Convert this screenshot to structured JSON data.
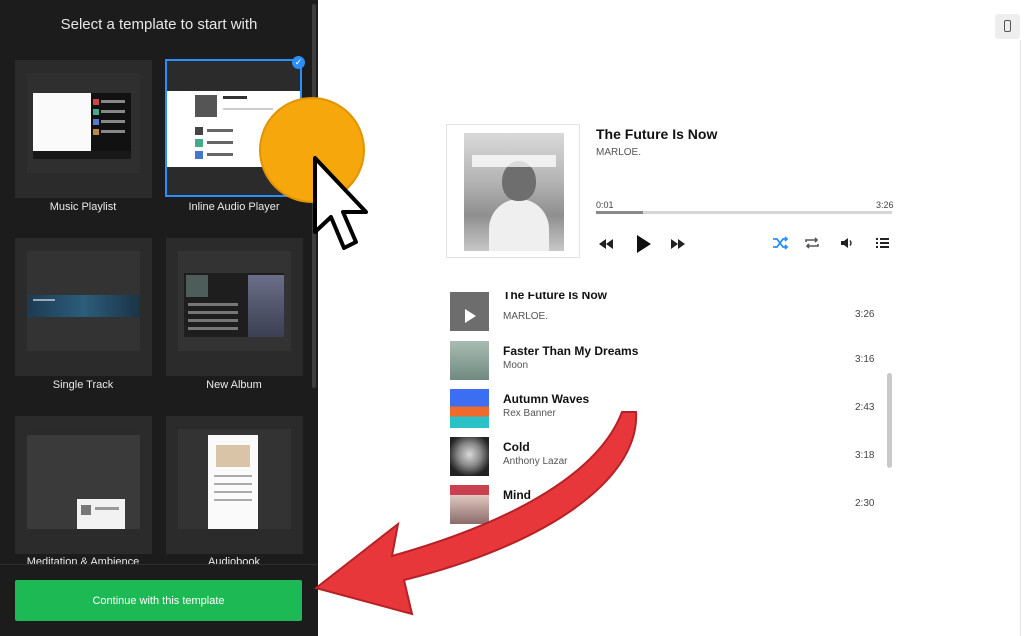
{
  "left_panel": {
    "title": "Select a template to start with",
    "templates": [
      {
        "label": "Music Playlist"
      },
      {
        "label": "Inline Audio Player",
        "selected": true
      },
      {
        "label": "Single Track"
      },
      {
        "label": "New Album"
      },
      {
        "label": "Meditation & Ambience"
      },
      {
        "label": "Audiobook"
      }
    ],
    "continue_label": "Continue with this template"
  },
  "preview": {
    "device_icon": "mobile-device-icon",
    "now_playing": {
      "title": "The Future Is Now",
      "artist": "MARLOE.",
      "current_time": "0:01",
      "total_time": "3:26",
      "progress": 0.16
    },
    "controls": [
      "rewind-icon",
      "play-icon",
      "fast-forward-icon",
      "shuffle-icon",
      "repeat-icon",
      "volume-icon",
      "playlist-icon"
    ],
    "accent_color": "#2c8ef8",
    "tracks": [
      {
        "title": "The Future Is Now",
        "artist": "MARLOE.",
        "duration": "3:26"
      },
      {
        "title": "Faster Than My Dreams",
        "artist": "Moon",
        "duration": "3:16"
      },
      {
        "title": "Autumn Waves",
        "artist": "Rex Banner",
        "duration": "2:43"
      },
      {
        "title": "Cold",
        "artist": "Anthony Lazar",
        "duration": "3:18"
      },
      {
        "title": "Mind",
        "artist": "",
        "duration": "2:30"
      }
    ]
  },
  "overlay": {
    "cursor_highlight_color": "#f5a70c",
    "arrow_color": "#e8373b"
  }
}
